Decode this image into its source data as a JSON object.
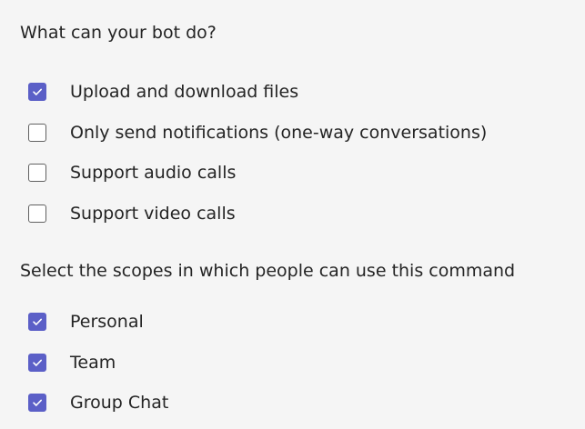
{
  "capabilities": {
    "heading": "What can your bot do?",
    "options": [
      {
        "label": "Upload and download files",
        "checked": true
      },
      {
        "label": "Only send notifications (one-way conversations)",
        "checked": false
      },
      {
        "label": "Support audio calls",
        "checked": false
      },
      {
        "label": "Support video calls",
        "checked": false
      }
    ]
  },
  "scopes": {
    "heading": "Select the scopes in which people can use this command",
    "options": [
      {
        "label": "Personal",
        "checked": true
      },
      {
        "label": "Team",
        "checked": true
      },
      {
        "label": "Group Chat",
        "checked": true
      }
    ]
  },
  "colors": {
    "accent": "#5b5fc7",
    "background": "#f5f5f5",
    "text": "#242424",
    "checkbox_border": "#616161"
  }
}
